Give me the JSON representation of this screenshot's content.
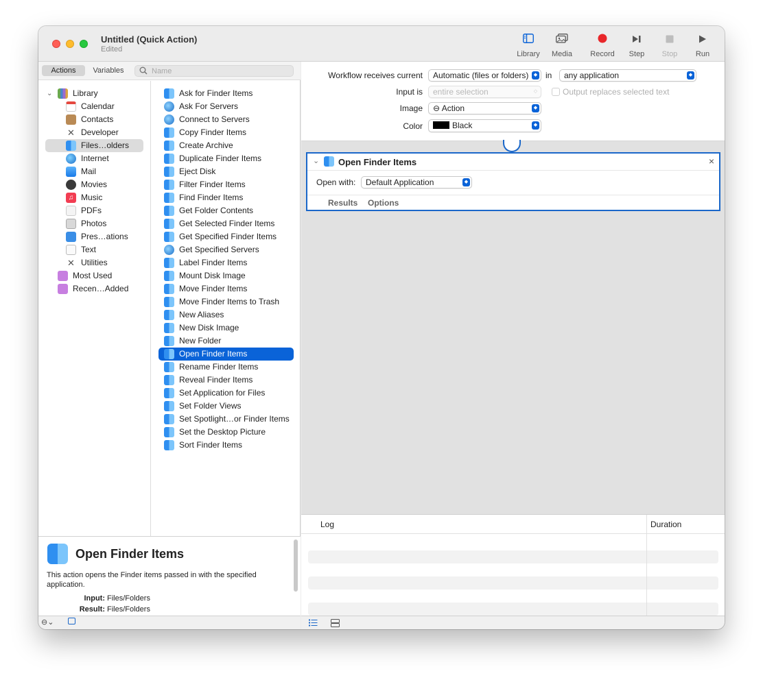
{
  "window": {
    "title": "Untitled (Quick Action)",
    "subtitle": "Edited"
  },
  "toolbar": {
    "library": "Library",
    "media": "Media",
    "record": "Record",
    "step": "Step",
    "stop": "Stop",
    "run": "Run"
  },
  "library_pane": {
    "tabs": [
      "Actions",
      "Variables"
    ],
    "search_placeholder": "Name",
    "categories": [
      {
        "label": "Library",
        "icon": "library-icon"
      },
      {
        "label": "Calendar",
        "icon": "calendar-icon"
      },
      {
        "label": "Contacts",
        "icon": "contacts-icon"
      },
      {
        "label": "Developer",
        "icon": "developer-icon"
      },
      {
        "label": "Files…olders",
        "icon": "finder-icon"
      },
      {
        "label": "Internet",
        "icon": "internet-icon"
      },
      {
        "label": "Mail",
        "icon": "mail-icon"
      },
      {
        "label": "Movies",
        "icon": "movies-icon"
      },
      {
        "label": "Music",
        "icon": "music-icon"
      },
      {
        "label": "PDFs",
        "icon": "pdf-icon"
      },
      {
        "label": "Photos",
        "icon": "photos-icon"
      },
      {
        "label": "Pres…ations",
        "icon": "presentations-icon"
      },
      {
        "label": "Text",
        "icon": "text-icon"
      },
      {
        "label": "Utilities",
        "icon": "utilities-icon"
      },
      {
        "label": "Most Used",
        "icon": "smart-folder-icon"
      },
      {
        "label": "Recen…Added",
        "icon": "smart-folder-icon"
      }
    ],
    "actions": [
      "Ask for Finder Items",
      "Ask For Servers",
      "Connect to Servers",
      "Copy Finder Items",
      "Create Archive",
      "Duplicate Finder Items",
      "Eject Disk",
      "Filter Finder Items",
      "Find Finder Items",
      "Get Folder Contents",
      "Get Selected Finder Items",
      "Get Specified Finder Items",
      "Get Specified Servers",
      "Label Finder Items",
      "Mount Disk Image",
      "Move Finder Items",
      "Move Finder Items to Trash",
      "New Aliases",
      "New Disk Image",
      "New Folder",
      "Open Finder Items",
      "Rename Finder Items",
      "Reveal Finder Items",
      "Set Application for Files",
      "Set Folder Views",
      "Set Spotlight…or Finder Items",
      "Set the Desktop Picture",
      "Sort Finder Items"
    ],
    "description": {
      "title": "Open Finder Items",
      "text": "This action opens the Finder items passed in with the specified application.",
      "input_label": "Input:",
      "input_value": "Files/Folders",
      "result_label": "Result:",
      "result_value": "Files/Folders"
    }
  },
  "workflow": {
    "receives_label": "Workflow receives current",
    "receives_value": "Automatic (files or folders)",
    "in_label": "in",
    "app_value": "any application",
    "input_is_label": "Input is",
    "input_is_value": "entire selection",
    "output_replaces_label": "Output replaces selected text",
    "image_label": "Image",
    "image_value": "⊖ Action",
    "color_label": "Color",
    "color_value": "Black",
    "color_swatch": "#000000"
  },
  "action_card": {
    "title": "Open Finder Items",
    "open_with_label": "Open with:",
    "open_with_value": "Default Application",
    "tabs": [
      "Results",
      "Options"
    ],
    "close": "×"
  },
  "log": {
    "col_log": "Log",
    "col_duration": "Duration"
  },
  "colors": {
    "accent": "#0a63d8",
    "record_red": "#e8262a"
  }
}
